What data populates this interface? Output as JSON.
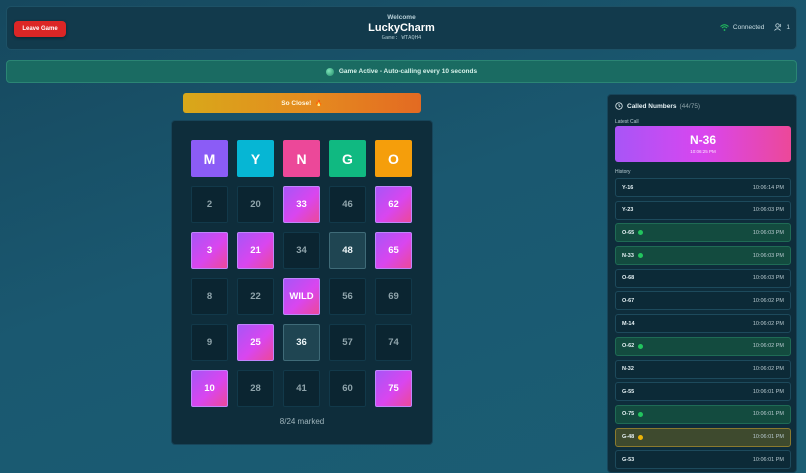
{
  "header": {
    "leave_label": "Leave Game",
    "welcome": "Welcome",
    "player_name": "LuckyCharm",
    "game_code": "Game: WTAQH4",
    "connection": "Connected",
    "player_count": "1"
  },
  "status": {
    "text": "Game Active - Auto-calling every 10 seconds",
    "icon": "globe-icon"
  },
  "banner": {
    "text": "So Close!",
    "emoji": "🔥"
  },
  "board": {
    "headers": [
      {
        "letter": "M",
        "color": "#8b5cf6"
      },
      {
        "letter": "Y",
        "color": "#06b6d4"
      },
      {
        "letter": "N",
        "color": "#ec4899"
      },
      {
        "letter": "G",
        "color": "#10b981"
      },
      {
        "letter": "O",
        "color": "#f59e0b"
      }
    ],
    "rows": [
      [
        {
          "v": "2",
          "s": ""
        },
        {
          "v": "20",
          "s": ""
        },
        {
          "v": "33",
          "s": "marked"
        },
        {
          "v": "46",
          "s": ""
        },
        {
          "v": "62",
          "s": "marked"
        }
      ],
      [
        {
          "v": "3",
          "s": "marked"
        },
        {
          "v": "21",
          "s": "marked"
        },
        {
          "v": "34",
          "s": ""
        },
        {
          "v": "48",
          "s": "recent"
        },
        {
          "v": "65",
          "s": "marked"
        }
      ],
      [
        {
          "v": "8",
          "s": ""
        },
        {
          "v": "22",
          "s": ""
        },
        {
          "v": "WILD",
          "s": "marked"
        },
        {
          "v": "56",
          "s": ""
        },
        {
          "v": "69",
          "s": ""
        }
      ],
      [
        {
          "v": "9",
          "s": ""
        },
        {
          "v": "25",
          "s": "marked"
        },
        {
          "v": "36",
          "s": "recent"
        },
        {
          "v": "57",
          "s": ""
        },
        {
          "v": "74",
          "s": ""
        }
      ],
      [
        {
          "v": "10",
          "s": "marked"
        },
        {
          "v": "28",
          "s": ""
        },
        {
          "v": "41",
          "s": ""
        },
        {
          "v": "60",
          "s": ""
        },
        {
          "v": "75",
          "s": "marked"
        }
      ]
    ],
    "marked_text": "8/24 marked"
  },
  "called": {
    "title": "Called Numbers",
    "count": "(44/75)",
    "latest_label": "Latest Call",
    "latest_number": "N-36",
    "latest_time": "10:06:25 PM",
    "history_label": "History",
    "history": [
      {
        "num": "Y-16",
        "time": "10:06:14 PM",
        "s": ""
      },
      {
        "num": "Y-23",
        "time": "10:06:03 PM",
        "s": ""
      },
      {
        "num": "O-65",
        "time": "10:06:03 PM",
        "s": "green"
      },
      {
        "num": "N-33",
        "time": "10:06:03 PM",
        "s": "green"
      },
      {
        "num": "O-68",
        "time": "10:06:03 PM",
        "s": ""
      },
      {
        "num": "O-67",
        "time": "10:06:02 PM",
        "s": ""
      },
      {
        "num": "M-14",
        "time": "10:06:02 PM",
        "s": ""
      },
      {
        "num": "O-62",
        "time": "10:06:02 PM",
        "s": "green"
      },
      {
        "num": "N-32",
        "time": "10:06:02 PM",
        "s": ""
      },
      {
        "num": "G-55",
        "time": "10:06:01 PM",
        "s": ""
      },
      {
        "num": "O-75",
        "time": "10:06:01 PM",
        "s": "green"
      },
      {
        "num": "G-48",
        "time": "10:06:01 PM",
        "s": "gold"
      },
      {
        "num": "G-53",
        "time": "10:06:01 PM",
        "s": ""
      }
    ]
  }
}
